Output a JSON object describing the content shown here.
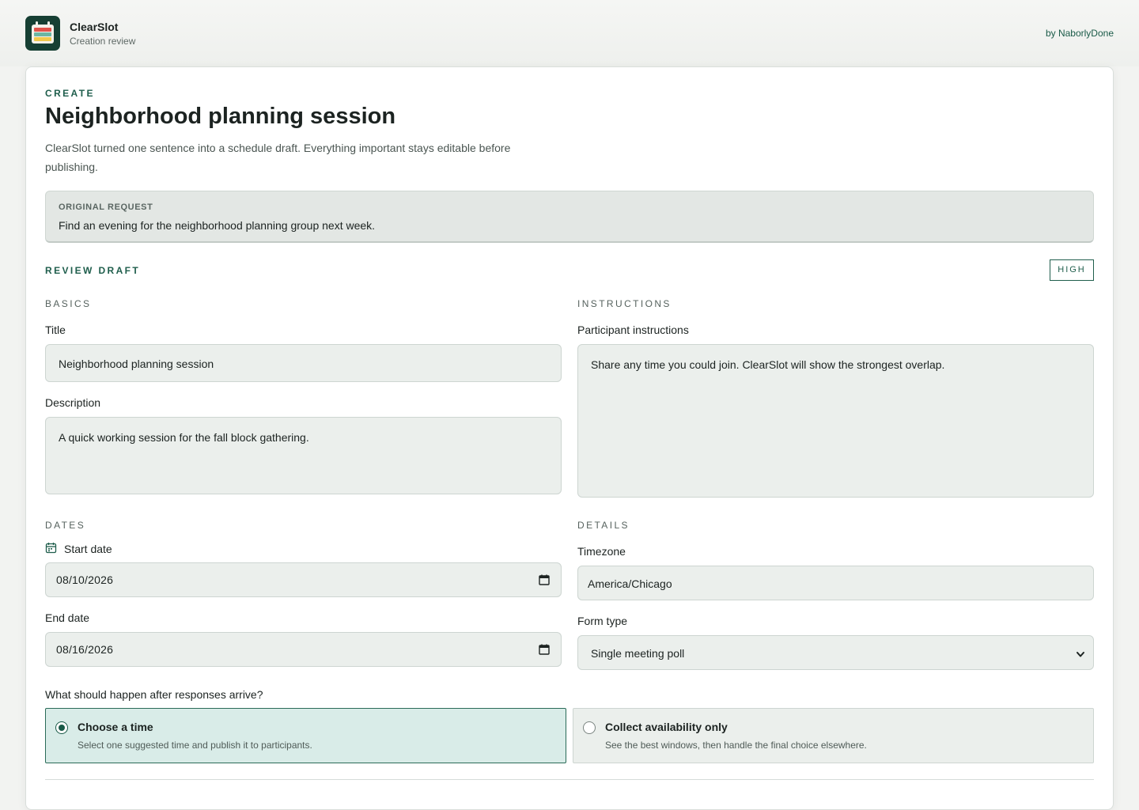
{
  "app": {
    "name": "ClearSlot",
    "subtitle": "Creation review",
    "byline": "by NaborlyDone",
    "accent": "#1f5e4c",
    "logo_colors": [
      "#163f33",
      "#e0524a",
      "#6bb6a3",
      "#f2c94c"
    ]
  },
  "header": {
    "kicker": "CREATE",
    "title": "Neighborhood planning session",
    "lede": "ClearSlot turned one sentence into a schedule draft. Everything important stays editable before publishing."
  },
  "original_request": {
    "label": "ORIGINAL REQUEST",
    "text": "Find an evening for the neighborhood planning group next week."
  },
  "review": {
    "label": "REVIEW DRAFT",
    "confidence_badge": "HIGH"
  },
  "basics": {
    "section": "BASICS",
    "title_label": "Title",
    "title_value": "Neighborhood planning session",
    "description_label": "Description",
    "description_value": "A quick working session for the fall block gathering."
  },
  "instructions": {
    "section": "INSTRUCTIONS",
    "label": "Participant instructions",
    "value": "Share any time you could join. ClearSlot will show the strongest overlap."
  },
  "dates": {
    "section": "DATES",
    "start_label": "Start date",
    "start_value": "08/10/2026",
    "end_label": "End date",
    "end_value": "08/16/2026",
    "icon": "calendar-icon"
  },
  "details": {
    "section": "DETAILS",
    "timezone_label": "Timezone",
    "timezone_value": "America/Chicago",
    "form_type_label": "Form type",
    "form_type_value": "Single meeting poll"
  },
  "outcome": {
    "question": "What should happen after responses arrive?",
    "options": [
      {
        "title": "Choose a time",
        "description": "Select one suggested time and publish it to participants.",
        "selected": true
      },
      {
        "title": "Collect availability only",
        "description": "See the best windows, then handle the final choice elsewhere.",
        "selected": false
      }
    ]
  }
}
